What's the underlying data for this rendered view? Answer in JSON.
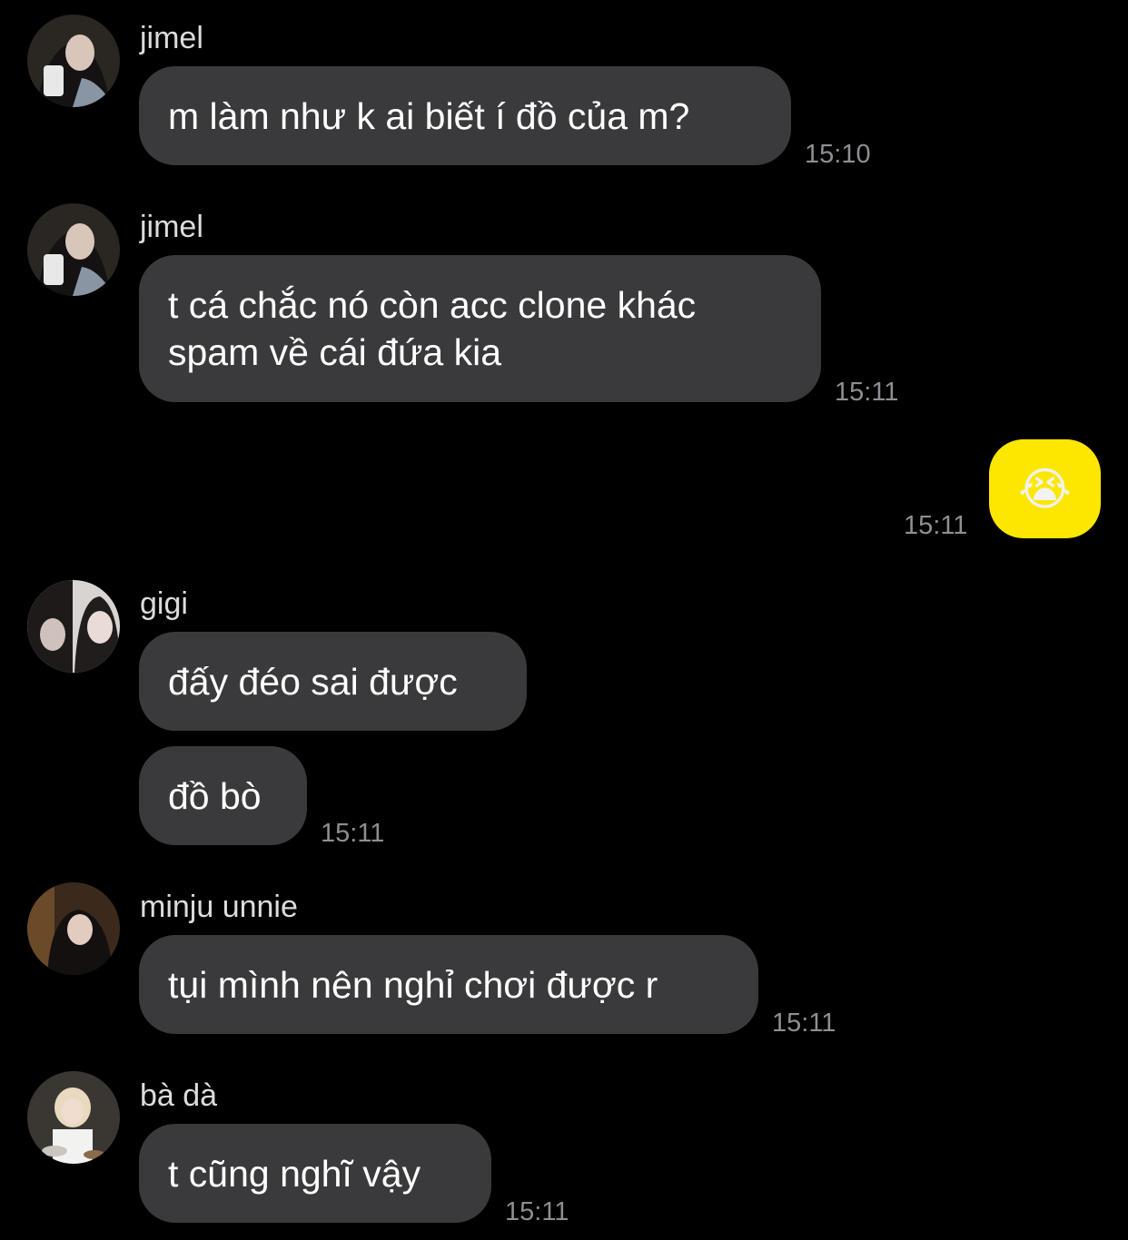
{
  "colors": {
    "background": "#000000",
    "incoming_bubble": "#3a3a3c",
    "outgoing_bubble": "#fde700",
    "timestamp": "#8e8e93"
  },
  "messages": [
    {
      "sender": "jimel",
      "lines": [
        "m làm như k ai biết í đồ của m?"
      ],
      "time": "15:10"
    },
    {
      "sender": "jimel",
      "lines": [
        "t cá chắc nó còn acc clone khác",
        "spam về cái đứa kia"
      ],
      "time": "15:11"
    },
    {
      "sender": "me",
      "emoji": "😭",
      "emoji_name": "loudly-crying-face-icon",
      "time": "15:11"
    },
    {
      "sender": "gigi",
      "lines": [
        "đấy đéo sai được"
      ]
    },
    {
      "sender": "gigi",
      "lines": [
        "đồ bò"
      ],
      "time": "15:11"
    },
    {
      "sender": "minju unnie",
      "lines": [
        "tụi mình nên nghỉ chơi được r"
      ],
      "time": "15:11"
    },
    {
      "sender": "bà dà",
      "lines": [
        "t cũng nghĩ vậy"
      ],
      "time": "15:11"
    }
  ]
}
